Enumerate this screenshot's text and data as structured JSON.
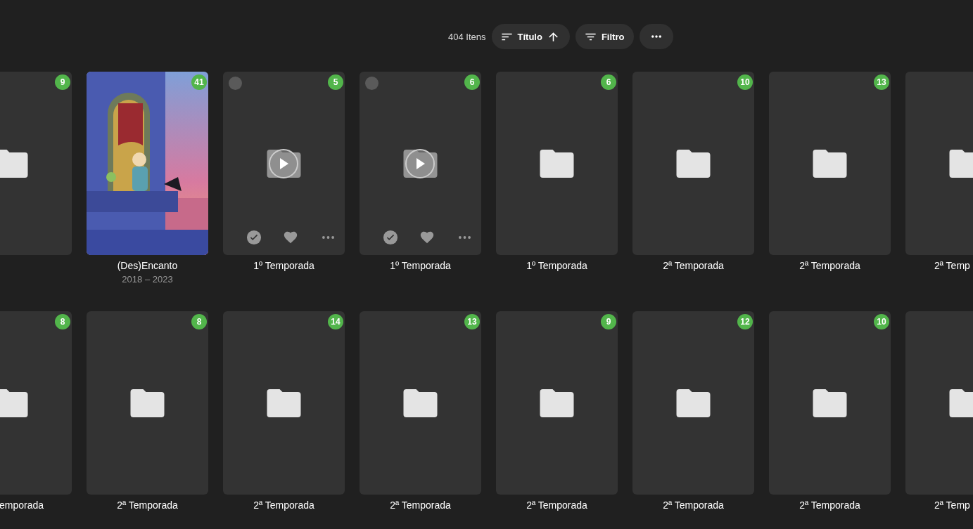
{
  "toolbar": {
    "count": "404 Itens",
    "sort_button": {
      "label": "Título"
    },
    "filter_button": {
      "label": "Filtro"
    }
  },
  "rows": [
    [
      {
        "kind": "folder",
        "count": "9",
        "hovered": false
      },
      {
        "kind": "poster",
        "count": "41",
        "title": "(Des)Encanto",
        "subtitle": "2018 – 2023",
        "hovered": false
      },
      {
        "kind": "folder",
        "count": "5",
        "title": "1º Temporada",
        "hovered": true
      },
      {
        "kind": "folder",
        "count": "6",
        "title": "1º Temporada",
        "hovered": true
      },
      {
        "kind": "folder",
        "count": "6",
        "title": "1º Temporada",
        "hovered": false
      },
      {
        "kind": "folder",
        "count": "10",
        "title": "2ª Temporada",
        "hovered": false
      },
      {
        "kind": "folder",
        "count": "13",
        "title": "2ª Temporada",
        "hovered": false
      },
      {
        "kind": "folder",
        "title": "2ª Temp",
        "hovered": false
      }
    ],
    [
      {
        "kind": "folder",
        "count": "8",
        "title": "emporada",
        "hovered": false
      },
      {
        "kind": "folder",
        "count": "8",
        "title": "2ª Temporada",
        "hovered": false
      },
      {
        "kind": "folder",
        "count": "14",
        "title": "2ª Temporada",
        "hovered": false
      },
      {
        "kind": "folder",
        "count": "13",
        "title": "2ª Temporada",
        "hovered": false
      },
      {
        "kind": "folder",
        "count": "9",
        "title": "2ª Temporada",
        "hovered": false
      },
      {
        "kind": "folder",
        "count": "12",
        "title": "2ª Temporada",
        "hovered": false
      },
      {
        "kind": "folder",
        "count": "10",
        "title": "2ª Temporada",
        "hovered": false
      },
      {
        "kind": "folder",
        "title": "2ª Temp",
        "hovered": false
      }
    ]
  ]
}
